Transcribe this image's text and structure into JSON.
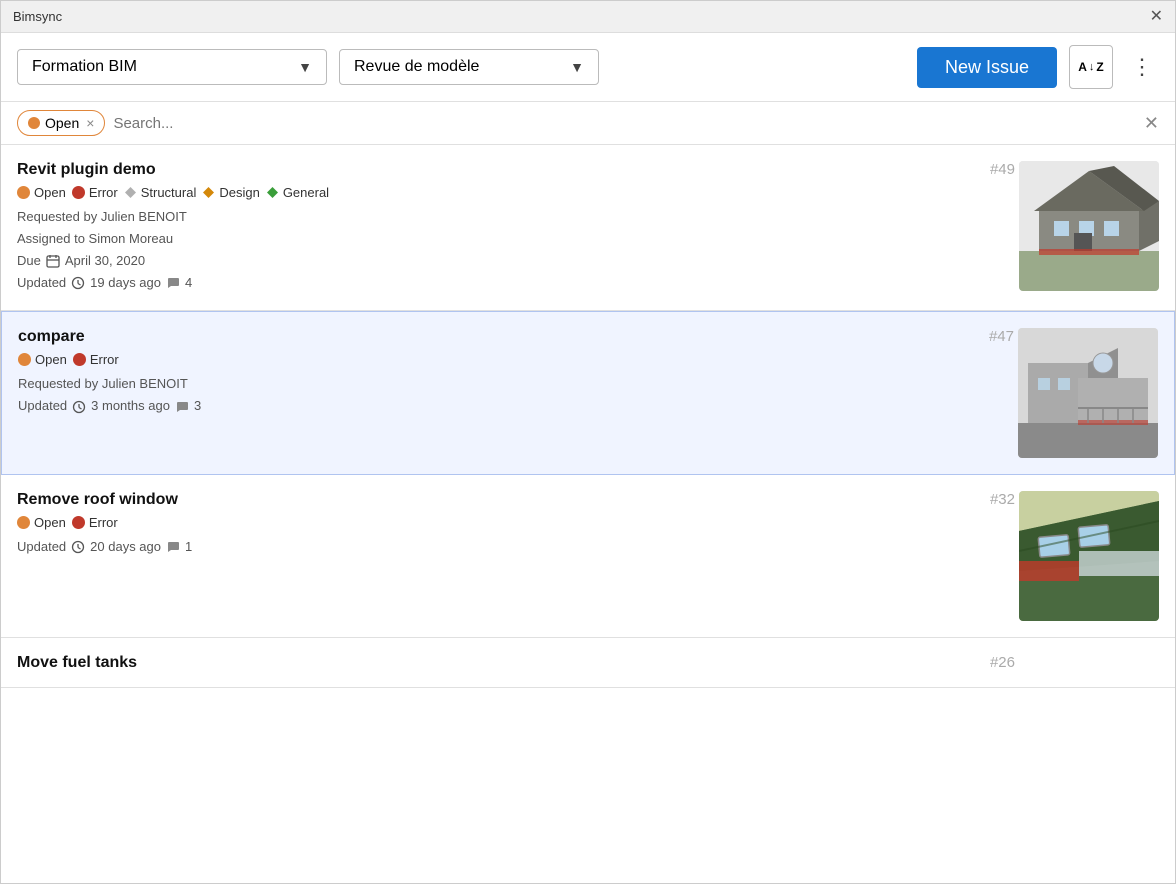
{
  "window": {
    "title": "Bimsync",
    "close_label": "✕"
  },
  "toolbar": {
    "project_label": "Formation BIM",
    "project_arrow": "▼",
    "phase_label": "Revue de modèle",
    "phase_arrow": "▼",
    "new_issue_label": "New Issue",
    "sort_icon": "sort-az-icon",
    "more_icon": "⋮"
  },
  "filter_bar": {
    "filter_tag_label": "Open",
    "filter_tag_close": "×",
    "search_placeholder": "Search...",
    "clear_icon": "✕"
  },
  "issues": [
    {
      "id": "issue-49",
      "number": "#49",
      "title": "Revit plugin demo",
      "tags": [
        {
          "type": "dot",
          "color": "#e0863a",
          "label": "Open"
        },
        {
          "type": "dot",
          "color": "#c0392b",
          "label": "Error"
        },
        {
          "type": "chip",
          "shape": "diamond",
          "color": "#b0b0b0",
          "label": "Structural"
        },
        {
          "type": "chip",
          "shape": "diamond",
          "color": "#d4880a",
          "label": "Design"
        },
        {
          "type": "chip",
          "shape": "diamond",
          "color": "#3a9e3a",
          "label": "General"
        }
      ],
      "requested_by": "Requested by Julien BENOIT",
      "assigned_to": "Assigned to Simon Moreau",
      "due": "Due  April 30, 2020",
      "updated": "Updated  19 days ago  💬 4",
      "selected": false
    },
    {
      "id": "issue-47",
      "number": "#47",
      "title": "compare",
      "tags": [
        {
          "type": "dot",
          "color": "#e0863a",
          "label": "Open"
        },
        {
          "type": "dot",
          "color": "#c0392b",
          "label": "Error"
        }
      ],
      "requested_by": "Requested by Julien BENOIT",
      "assigned_to": "",
      "due": "",
      "updated": "Updated  3 months ago  💬 3",
      "selected": true
    },
    {
      "id": "issue-32",
      "number": "#32",
      "title": "Remove roof window",
      "tags": [
        {
          "type": "dot",
          "color": "#e0863a",
          "label": "Open"
        },
        {
          "type": "dot",
          "color": "#c0392b",
          "label": "Error"
        }
      ],
      "requested_by": "",
      "assigned_to": "",
      "due": "",
      "updated": "Updated  20 days ago  💬 1",
      "selected": false
    },
    {
      "id": "issue-26",
      "number": "#26",
      "title": "Move fuel tanks",
      "tags": [],
      "requested_by": "",
      "assigned_to": "",
      "due": "",
      "updated": "",
      "selected": false
    }
  ]
}
